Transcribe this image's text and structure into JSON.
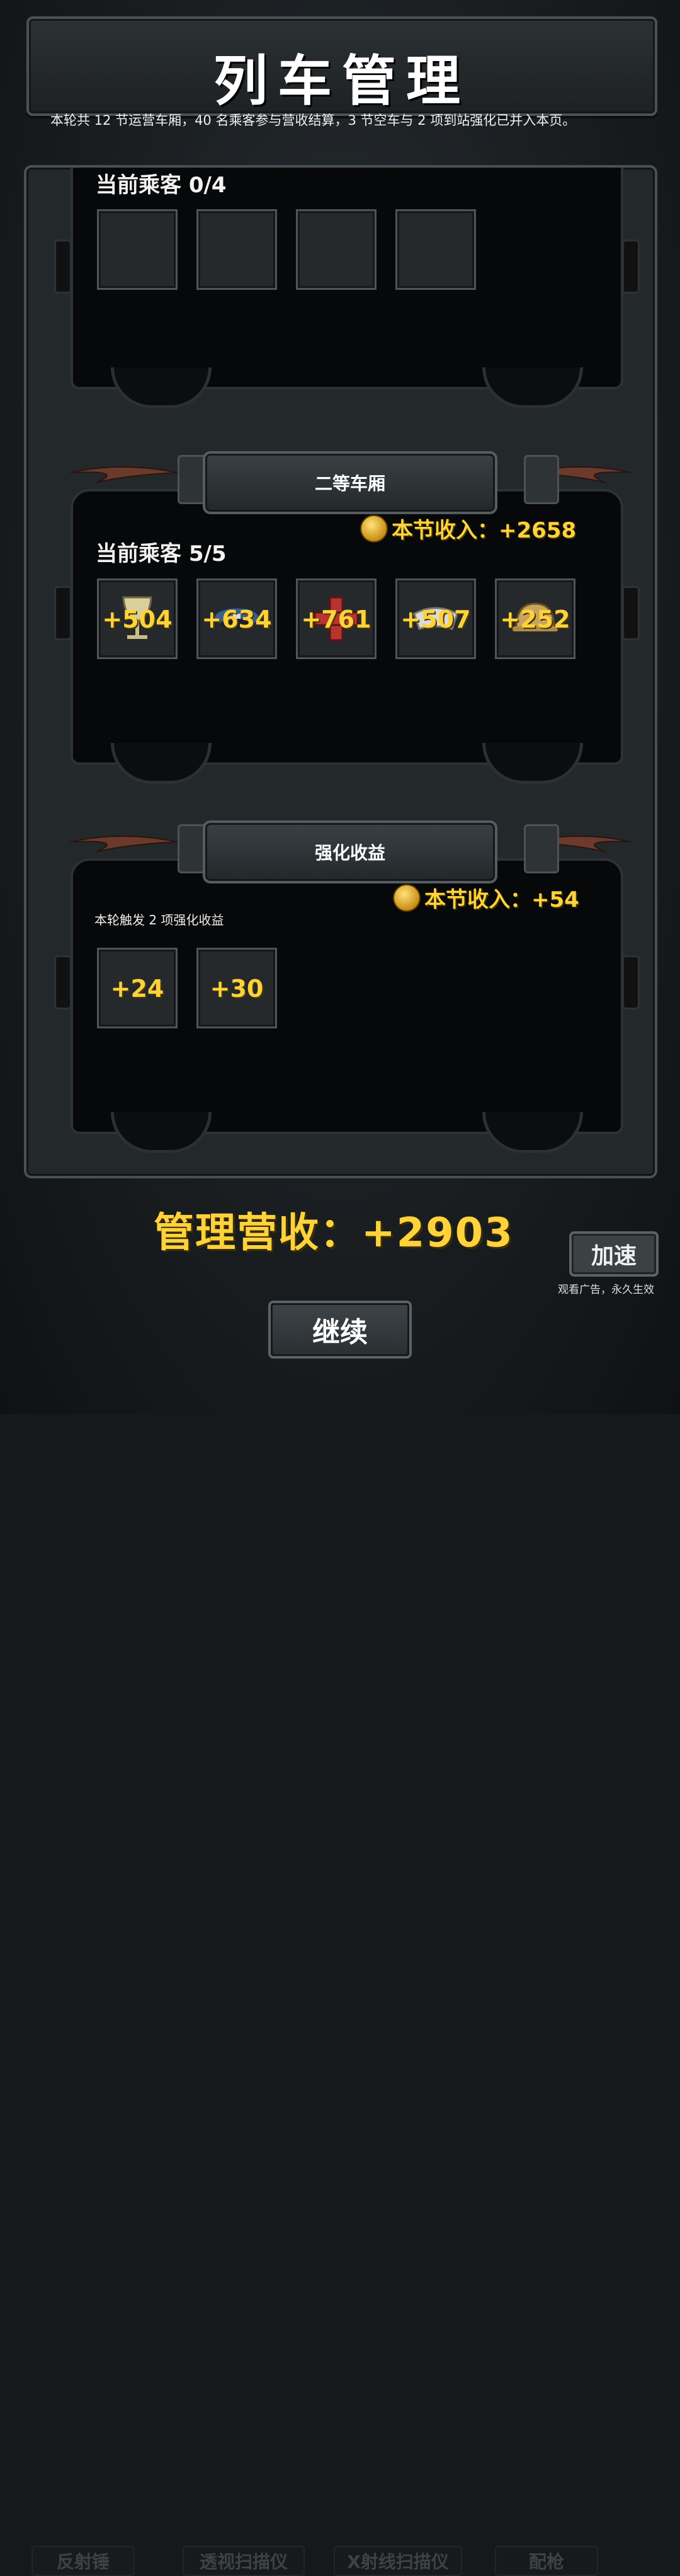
{
  "title": "列车管理",
  "summary": "本轮共 12 节运营车厢，40 名乘客参与营收结算，3 节空车与 2 项到站强化已并入本页。",
  "carriage_empty": {
    "passenger_label": "当前乘客 0/4",
    "slots": 4
  },
  "carriage_second": {
    "header": "二等车厢",
    "income": "本节收入：+2658",
    "passenger_label": "当前乘客 5/5",
    "slots": [
      {
        "icon": "goblet-icon",
        "value": "+504"
      },
      {
        "icon": "conductor-cap-icon",
        "value": "+634"
      },
      {
        "icon": "medical-cross-icon",
        "value": "+761"
      },
      {
        "icon": "chef-hat-icon",
        "value": "+507"
      },
      {
        "icon": "hard-hat-icon",
        "value": "+252"
      }
    ]
  },
  "upgrades": {
    "header": "强化收益",
    "income": "本节收入：+54",
    "note": "本轮触发 2 项强化收益",
    "slots": [
      {
        "value": "+24"
      },
      {
        "value": "+30"
      }
    ]
  },
  "total": "管理营收：+2903",
  "speed_button": "加速",
  "speed_note": "观看广告，永久生效",
  "continue_button": "继续",
  "background_labels": [
    "反射锤",
    "透视扫描仪",
    "X射线扫描仪",
    "配枪"
  ],
  "colors": {
    "accent_gold": "#ffd23c",
    "panel": "#23282b",
    "carriage": "#070809"
  }
}
